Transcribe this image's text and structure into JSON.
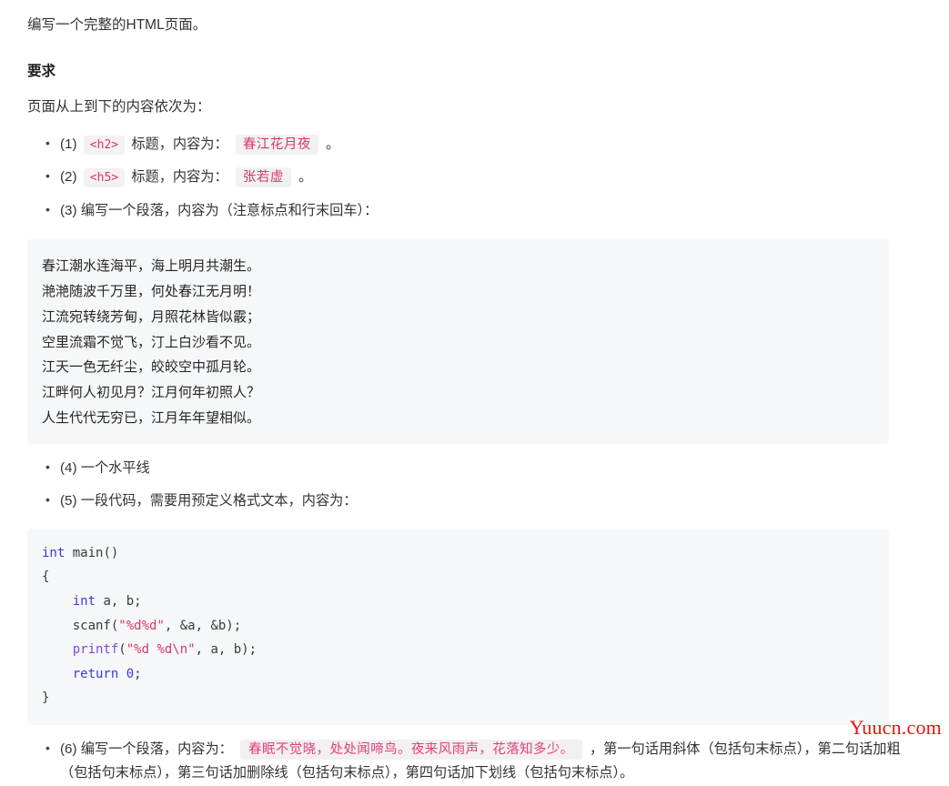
{
  "document": {
    "intro": "编写一个完整的HTML页面。",
    "section_heading": "要求",
    "lead": "页面从上到下的内容依次为："
  },
  "requirements": [
    {
      "index": "(1)",
      "before_code": "",
      "tag": "<h2>",
      "mid": "标题，内容为：",
      "value": "春江花月夜",
      "after": "。"
    },
    {
      "index": "(2)",
      "before_code": "",
      "tag": "<h5>",
      "mid": "标题，内容为：",
      "value": "张若虚",
      "after": "。"
    },
    {
      "index": "(3)",
      "text": "编写一个段落，内容为（注意标点和行末回车）："
    },
    {
      "index": "(4)",
      "text": "一个水平线"
    },
    {
      "index": "(5)",
      "text": "一段代码，需要用预定义格式文本，内容为："
    },
    {
      "index": "(6)",
      "prefix": "编写一个段落，内容为：",
      "highlight": "春眠不觉晓，处处闻啼鸟。夜来风雨声，花落知多少。",
      "suffix": "，第一句话用斜体（包括句末标点），第二句话加粗（包括句末标点），第三句话加删除线（包括句末标点），第四句话加下划线（包括句末标点）。"
    }
  ],
  "poem": {
    "lines": [
      "春江潮水连海平，海上明月共潮生。",
      "滟滟随波千万里，何处春江无月明！",
      "江流宛转绕芳甸，月照花林皆似霰；",
      "空里流霜不觉飞，汀上白沙看不见。",
      "江天一色无纤尘，皎皎空中孤月轮。",
      "江畔何人初见月？江月何年初照人？",
      "人生代代无穷已，江月年年望相似。"
    ],
    "text": "春江潮水连海平，海上明月共潮生。\n滟滟随波千万里，何处春江无月明！\n江流宛转绕芳甸，月照花林皆似霰；\n空里流霜不觉飞，汀上白沙看不见。\n江天一色无纤尘，皎皎空中孤月轮。\n江畔何人初见月？江月何年初照人？\n人生代代无穷已，江月年年望相似。"
  },
  "code": {
    "language": "c",
    "lines": [
      {
        "tokens": [
          {
            "t": "int",
            "c": "tok-kw"
          },
          {
            "t": " main()",
            "c": "tok-plain"
          }
        ]
      },
      {
        "tokens": [
          {
            "t": "{",
            "c": "tok-plain"
          }
        ]
      },
      {
        "tokens": [
          {
            "t": "    ",
            "c": "tok-plain"
          },
          {
            "t": "int",
            "c": "tok-kw"
          },
          {
            "t": " a, b;",
            "c": "tok-plain"
          }
        ]
      },
      {
        "tokens": [
          {
            "t": "    scanf(",
            "c": "tok-plain"
          },
          {
            "t": "\"%d%d\"",
            "c": "tok-str"
          },
          {
            "t": ", &a, &b);",
            "c": "tok-plain"
          }
        ]
      },
      {
        "tokens": [
          {
            "t": "    ",
            "c": "tok-plain"
          },
          {
            "t": "printf",
            "c": "tok-fn"
          },
          {
            "t": "(",
            "c": "tok-plain"
          },
          {
            "t": "\"%d %d\\n\"",
            "c": "tok-str"
          },
          {
            "t": ", a, b);",
            "c": "tok-plain"
          }
        ]
      },
      {
        "tokens": [
          {
            "t": "    ",
            "c": "tok-plain"
          },
          {
            "t": "return",
            "c": "tok-kw"
          },
          {
            "t": " ",
            "c": "tok-plain"
          },
          {
            "t": "0",
            "c": "tok-num"
          },
          {
            "t": ";",
            "c": "tok-plain"
          }
        ]
      },
      {
        "tokens": [
          {
            "t": "}",
            "c": "tok-plain"
          }
        ]
      }
    ]
  },
  "watermark": {
    "text": "Yuucn.com",
    "color": "#ee1111"
  },
  "colors": {
    "block_background": "#f6f7f8",
    "inline_code_background": "#f3f1f3",
    "inline_code_text": "#d6376c",
    "highlight_background": "#f4eff1",
    "highlight_text": "#e0417a",
    "body_text": "#333333",
    "keyword": "#3b39d4",
    "function": "#7a4bd8",
    "string": "#d6376c"
  }
}
